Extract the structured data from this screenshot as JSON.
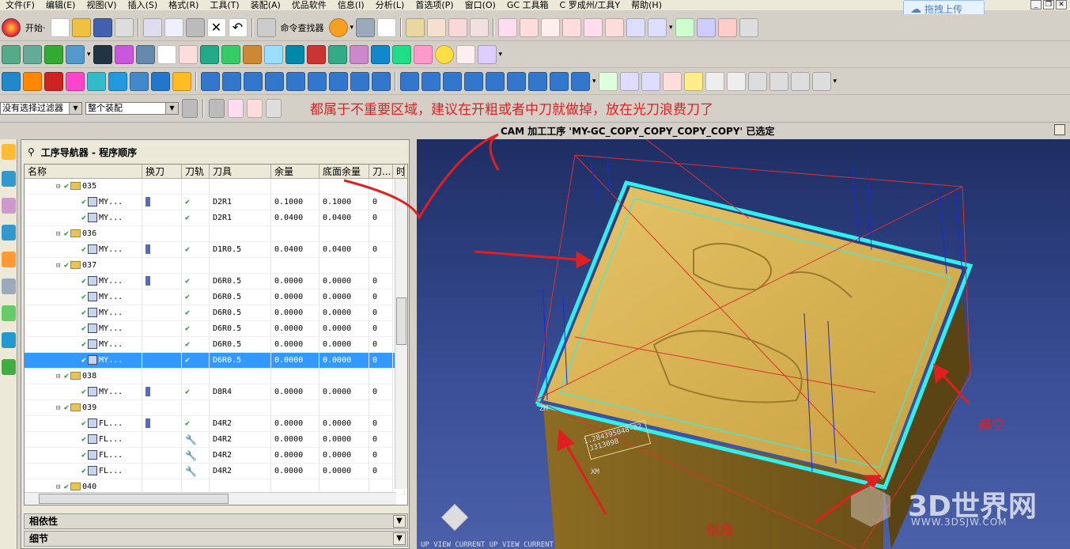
{
  "menu": [
    "文件(F)",
    "编辑(E)",
    "视图(V)",
    "插入(S)",
    "格式(R)",
    "工具(T)",
    "装配(A)",
    "优品软件",
    "信息(I)",
    "分析(L)",
    "首选项(P)",
    "窗口(O)",
    "GC 工具箱",
    "C 罗成州/工具Y",
    "帮助(H)"
  ],
  "cloud_button": "拖拽上传",
  "toolbar": {
    "start_label": "开始·",
    "command_finder": "命令查找器"
  },
  "filter": {
    "selection_filter": "没有选择过滤器",
    "scope": "整个装配"
  },
  "annotation_top": "都属于不重要区域，建议在开粗或者中刀就做掉，放在光刀浪费刀了",
  "status_text": "CAM 加工工序 'MY-GC_COPY_COPY_COPY_COPY' 已选定",
  "navigator": {
    "title": "工序导航器 - 程序顺序",
    "columns": [
      "名称",
      "换刀",
      "刀轨",
      "刀具",
      "余量",
      "底面余量",
      "刀...",
      "时"
    ],
    "rows": [
      {
        "level": 1,
        "name": "035",
        "group": true
      },
      {
        "level": 2,
        "name": "MY...",
        "tool_change": true,
        "path": true,
        "tool": "D2R1",
        "stock": "0.1000",
        "floor": "0.1000",
        "n": "0"
      },
      {
        "level": 2,
        "name": "MY...",
        "tool_change": false,
        "path": true,
        "tool": "D2R1",
        "stock": "0.0400",
        "floor": "0.0400",
        "n": "0"
      },
      {
        "level": 1,
        "name": "036",
        "group": true
      },
      {
        "level": 2,
        "name": "MY...",
        "tool_change": true,
        "path": true,
        "tool": "D1R0.5",
        "stock": "0.0400",
        "floor": "0.0400",
        "n": "0"
      },
      {
        "level": 1,
        "name": "037",
        "group": true
      },
      {
        "level": 2,
        "name": "MY...",
        "tool_change": true,
        "path": true,
        "tool": "D6R0.5",
        "stock": "0.0000",
        "floor": "0.0000",
        "n": "0"
      },
      {
        "level": 2,
        "name": "MY...",
        "tool_change": false,
        "path": true,
        "tool": "D6R0.5",
        "stock": "0.0000",
        "floor": "0.0000",
        "n": "0"
      },
      {
        "level": 2,
        "name": "MY...",
        "tool_change": false,
        "path": true,
        "tool": "D6R0.5",
        "stock": "0.0000",
        "floor": "0.0000",
        "n": "0"
      },
      {
        "level": 2,
        "name": "MY...",
        "tool_change": false,
        "path": true,
        "tool": "D6R0.5",
        "stock": "0.0000",
        "floor": "0.0000",
        "n": "0"
      },
      {
        "level": 2,
        "name": "MY...",
        "tool_change": false,
        "path": true,
        "tool": "D6R0.5",
        "stock": "0.0000",
        "floor": "0.0000",
        "n": "0"
      },
      {
        "level": 2,
        "name": "MY...",
        "tool_change": false,
        "path": true,
        "tool": "D6R0.5",
        "stock": "0.0000",
        "floor": "0.0000",
        "n": "0",
        "selected": true
      },
      {
        "level": 1,
        "name": "038",
        "group": true
      },
      {
        "level": 2,
        "name": "MY...",
        "tool_change": true,
        "path": true,
        "tool": "D8R4",
        "stock": "0.0000",
        "floor": "0.0000",
        "n": "0"
      },
      {
        "level": 1,
        "name": "039",
        "group": true
      },
      {
        "level": 2,
        "name": "FL...",
        "tool_change": true,
        "path": true,
        "tool": "D4R2",
        "stock": "0.0000",
        "floor": "0.0000",
        "n": "0"
      },
      {
        "level": 2,
        "name": "FL...",
        "tool_change": false,
        "path": false,
        "tool": "D4R2",
        "stock": "0.0000",
        "floor": "0.0000",
        "n": "0"
      },
      {
        "level": 2,
        "name": "FL...",
        "tool_change": false,
        "path": false,
        "tool": "D4R2",
        "stock": "0.0000",
        "floor": "0.0000",
        "n": "0"
      },
      {
        "level": 2,
        "name": "FL...",
        "tool_change": false,
        "path": false,
        "tool": "D4R2",
        "stock": "0.0000",
        "floor": "0.0000",
        "n": "0"
      },
      {
        "level": 1,
        "name": "040",
        "group": true
      }
    ],
    "sections": [
      "相依性",
      "细节"
    ]
  },
  "viewport": {
    "part_label_1": "1.284395048-82",
    "part_label_2": "J313098",
    "axis_zm": "ZM",
    "axis_xm": "XM",
    "view_text": "UP VIEW CURRENT  UP VIEW CURRENT",
    "annotation_clearance": "避空",
    "annotation_chamfer": "倒角"
  },
  "watermark": {
    "title": "3D世界网",
    "url": "WWW.3DSJW.COM"
  },
  "colors": {
    "accent_red": "#e02020",
    "toolpath_cyan": "#2ff0ee",
    "part_gold": "#d9b24c",
    "viewport_blue": "#2a3c80",
    "selection_blue": "#3399ff"
  }
}
